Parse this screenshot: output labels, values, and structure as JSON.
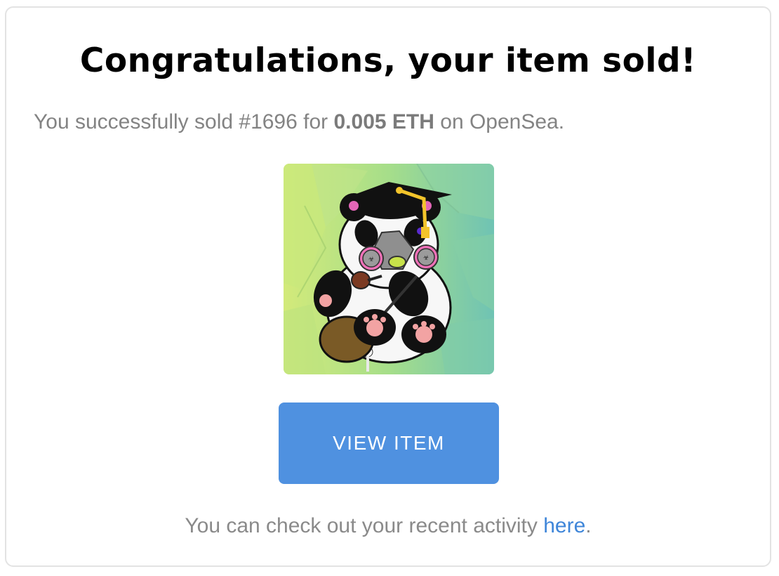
{
  "email": {
    "title": "Congratulations, your item sold!",
    "message": {
      "prefix": "You successfully sold #1696 for ",
      "price": "0.005 ETH",
      "suffix": " on OpenSea."
    },
    "item_image": {
      "icon": "panda-nft-image",
      "colors": {
        "background_start": "#d2ea7c",
        "background_end": "#6fc2b3",
        "cap": "#0b0b0b",
        "tassel": "#f3c42b",
        "mask": "#8f8f8f",
        "filter_pink": "#f071b8",
        "paw_pink": "#f2a3a3"
      }
    },
    "button_label": "VIEW ITEM",
    "footer": {
      "prefix": "You can check out your recent activity ",
      "link_text": "here",
      "suffix": "."
    },
    "colors": {
      "button": "#4f91e0",
      "link": "#3f86d9",
      "muted_text": "#838383"
    }
  }
}
